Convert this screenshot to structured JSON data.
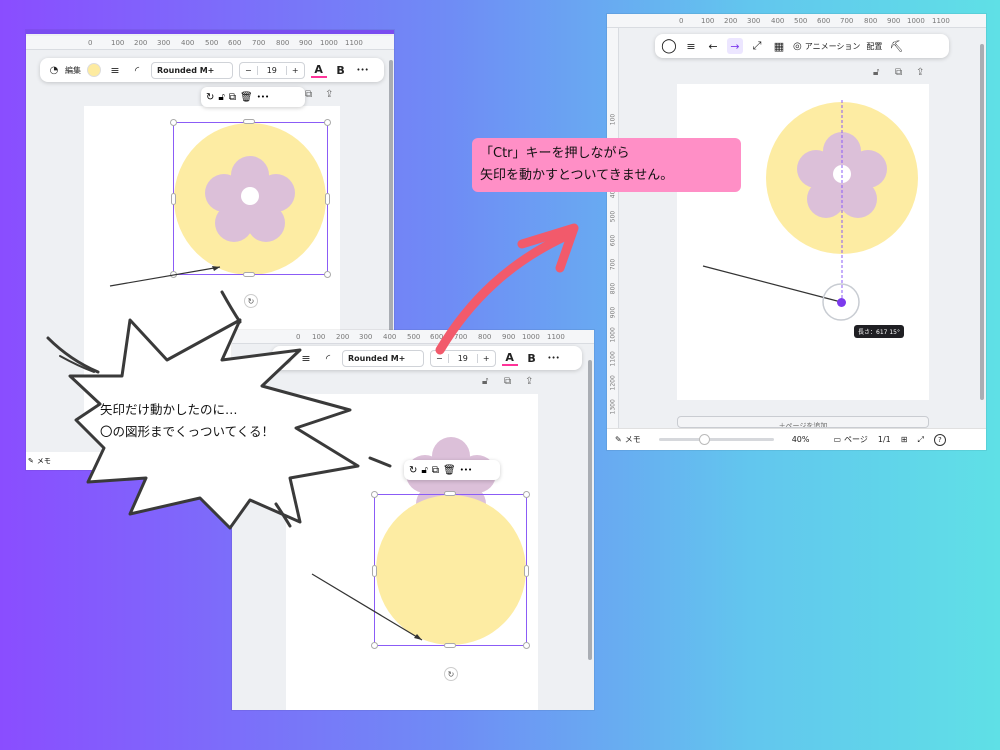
{
  "ruler": {
    "marks_a": [
      "0",
      "100",
      "200",
      "300",
      "400",
      "500",
      "600",
      "700",
      "800",
      "900",
      "1000",
      "1100"
    ],
    "marks_b": [
      "0",
      "100",
      "200",
      "300",
      "400",
      "500",
      "600",
      "700",
      "800",
      "900",
      "1000",
      "1100"
    ],
    "marks_c": [
      "0",
      "100",
      "200",
      "300",
      "400",
      "500",
      "600",
      "700",
      "800",
      "900",
      "1000",
      "1100"
    ],
    "vmarks_c": [
      "100",
      "200",
      "300",
      "400",
      "500",
      "600",
      "700",
      "800",
      "900",
      "1000",
      "1100",
      "1200",
      "1300"
    ]
  },
  "toolbar": {
    "edit_label": "編集",
    "font_name": "Rounded M+",
    "font_size": "19",
    "minus": "−",
    "plus": "+",
    "text_color_glyph": "A",
    "bold_glyph": "B",
    "more_glyph": "•••"
  },
  "arrow_toolbar": {
    "animation_label": "アニメーション",
    "position_label": "配置"
  },
  "status_bar": {
    "memo_label": "メモ",
    "zoom": "40%",
    "page_label": "ページ",
    "page_count": "1/1",
    "help_glyph": "?",
    "zoom_fraction": 0.4
  },
  "length_tooltip": "長さ：617 15°",
  "page_add_label": "＋ページを追加",
  "callouts": {
    "pink_line1": "「Ctr」キーを押しながら",
    "pink_line2": "矢印を動かすとついてきません。",
    "burst_line1": "矢印だけ動かしたのに…",
    "burst_line2": "〇の図形までくっついてくる！"
  },
  "colors": {
    "background_left": "#8a4dff",
    "background_right": "#5fe0e6",
    "circle_fill": "#fdeca3",
    "flower_fill": "#dcc0d9",
    "selection": "#8b5cf6",
    "pink_note": "#ff8fc6",
    "big_arrow": "#f25a6b"
  },
  "icons": [
    "shapes-icon",
    "lines-icon",
    "corner-icon",
    "text-color-icon",
    "bold-icon",
    "more-icon",
    "rotate-icon",
    "lock-icon",
    "duplicate-icon",
    "trash-icon",
    "add-page-icon",
    "notes-icon",
    "grid-icon",
    "fullscreen-icon",
    "help-icon",
    "arrow-left-icon",
    "arrow-right-icon",
    "line-diagonal-icon",
    "transparency-icon",
    "animation-icon",
    "paint-roller-icon"
  ]
}
